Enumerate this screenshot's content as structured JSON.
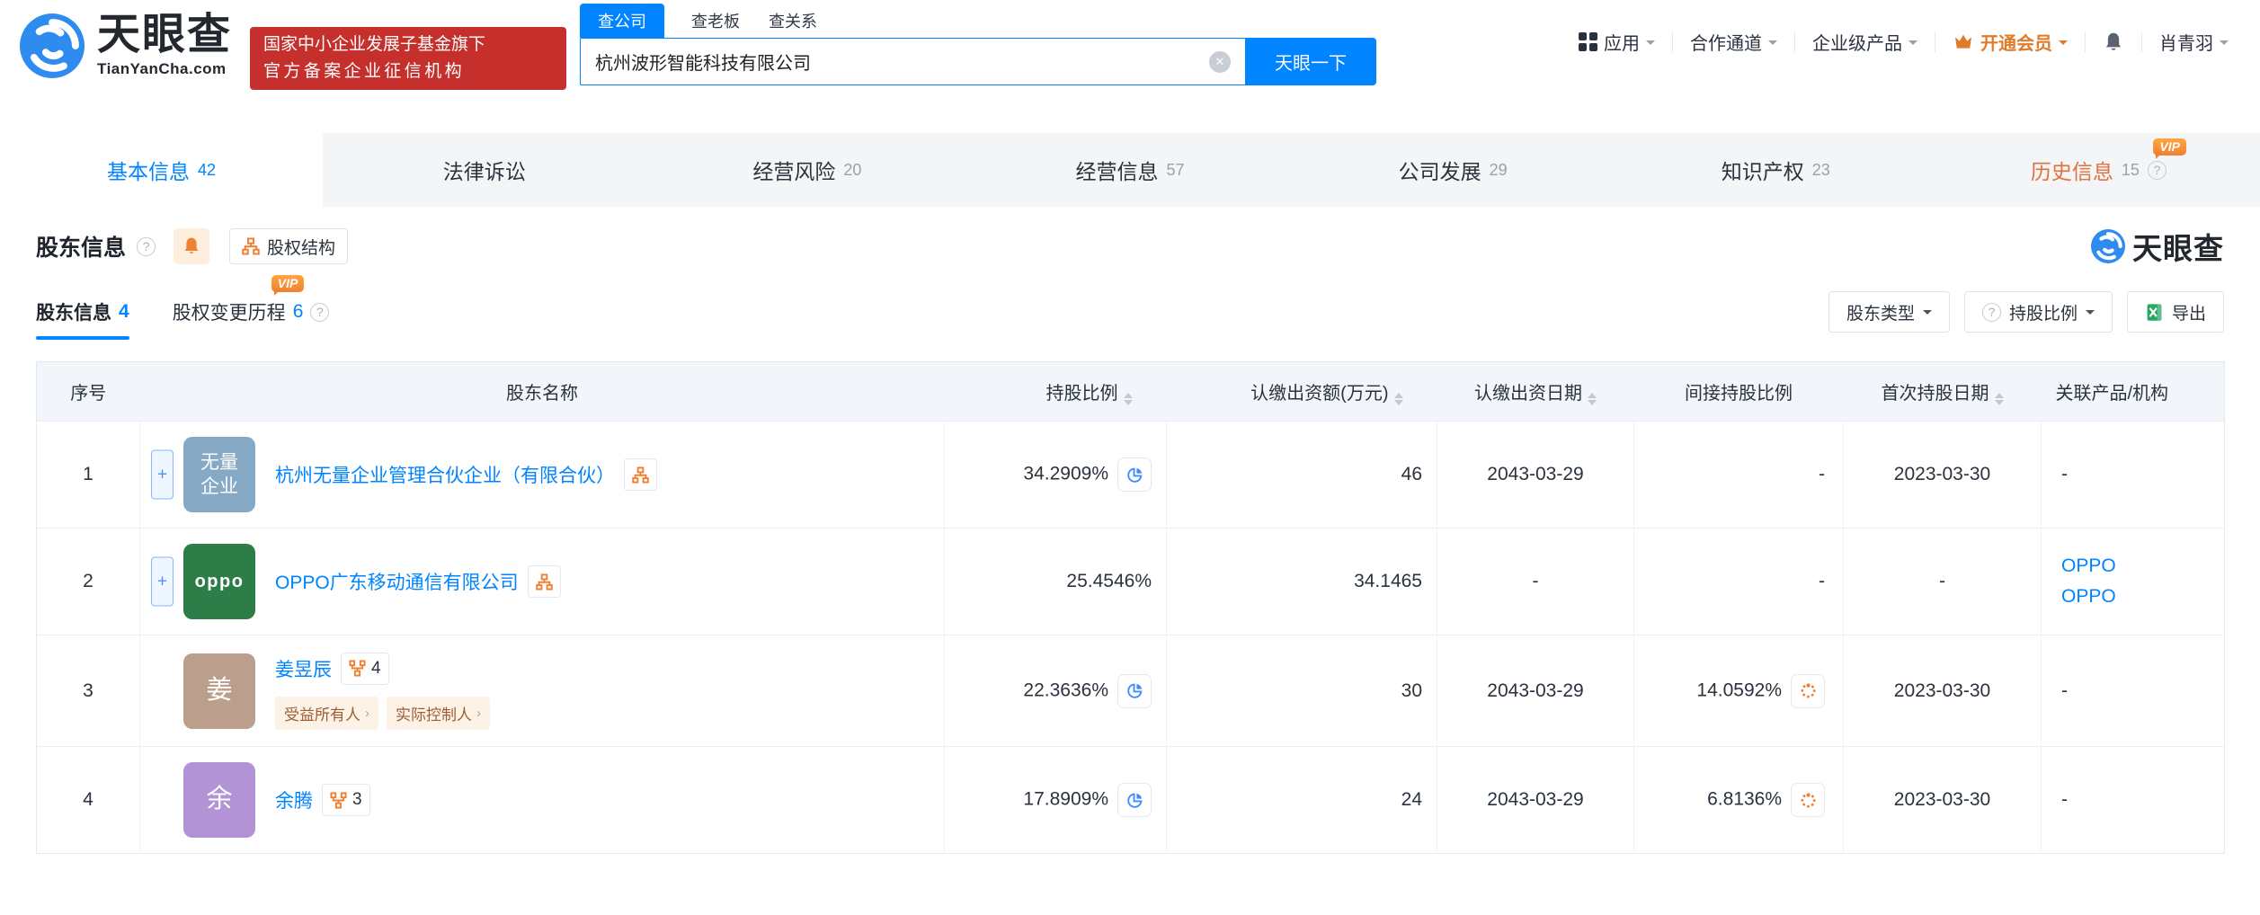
{
  "colors": {
    "accent_blue": "#0084ff",
    "badge_red": "#c5302c",
    "accent_orange": "#f08031",
    "history_tab_orange": "#de7140"
  },
  "vip_label": "VIP",
  "header": {
    "logo": {
      "title": "天眼查",
      "domain": "TianYanCha.com"
    },
    "cert_badge": {
      "line1": "国家中小企业发展子基金旗下",
      "line2": "官方备案企业征信机构"
    },
    "search": {
      "tabs": [
        {
          "label": "查公司"
        },
        {
          "label": "查老板"
        },
        {
          "label": "查关系"
        }
      ],
      "value": "杭州波形智能科技有限公司",
      "button": "天眼一下"
    },
    "nav": {
      "apps": "应用",
      "partner": "合作通道",
      "enterprise": "企业级产品",
      "vip": "开通会员",
      "user": "肖青羽"
    }
  },
  "tabstrip": [
    {
      "label": "基本信息",
      "count": "42"
    },
    {
      "label": "法律诉讼",
      "count": ""
    },
    {
      "label": "经营风险",
      "count": "20"
    },
    {
      "label": "经营信息",
      "count": "57"
    },
    {
      "label": "公司发展",
      "count": "29"
    },
    {
      "label": "知识产权",
      "count": "23"
    },
    {
      "label": "历史信息",
      "count": "15"
    }
  ],
  "section": {
    "title": "股东信息",
    "structure_button": "股权结构",
    "watermark": "天眼查",
    "subtabs": [
      {
        "label": "股东信息",
        "count": "4"
      },
      {
        "label": "股权变更历程",
        "count": "6"
      }
    ],
    "filters": {
      "shareholder_type": "股东类型",
      "ratio": "持股比例",
      "export": "导出"
    }
  },
  "table": {
    "expand_symbol": "+",
    "columns": [
      {
        "label": "序号"
      },
      {
        "label": "股东名称"
      },
      {
        "label": "持股比例"
      },
      {
        "label": "认缴出资额(万元)"
      },
      {
        "label": "认缴出资日期"
      },
      {
        "label": "间接持股比例"
      },
      {
        "label": "首次持股日期"
      },
      {
        "label": "关联产品/机构"
      }
    ],
    "rows": [
      {
        "index": "1",
        "avatar": {
          "line1": "无量",
          "line2": "企业",
          "color": "#86a9c5"
        },
        "name": "杭州无量企业管理合伙企业（有限合伙）",
        "ratio": "34.2909%",
        "amount": "46",
        "date": "2043-03-29",
        "indirect": "-",
        "first_date": "2023-03-30",
        "related": "-"
      },
      {
        "index": "2",
        "avatar": {
          "text": "oppo",
          "color": "#2d7d49"
        },
        "name": "OPPO广东移动通信有限公司",
        "ratio": "25.4546%",
        "amount": "34.1465",
        "date": "-",
        "indirect": "-",
        "first_date": "-",
        "related_links": [
          "OPPO",
          "OPPO"
        ]
      },
      {
        "index": "3",
        "avatar": {
          "text": "姜",
          "color": "#bb9e8c"
        },
        "name": "姜昱辰",
        "graph_count": "4",
        "tags": [
          "受益所有人",
          "实际控制人"
        ],
        "ratio": "22.3636%",
        "amount": "30",
        "date": "2043-03-29",
        "indirect": "14.0592%",
        "first_date": "2023-03-30",
        "related": "-"
      },
      {
        "index": "4",
        "avatar": {
          "text": "余",
          "color": "#b193d6"
        },
        "name": "余腾",
        "graph_count": "3",
        "ratio": "17.8909%",
        "amount": "24",
        "date": "2043-03-29",
        "indirect": "6.8136%",
        "first_date": "2023-03-30",
        "related": "-"
      }
    ]
  }
}
